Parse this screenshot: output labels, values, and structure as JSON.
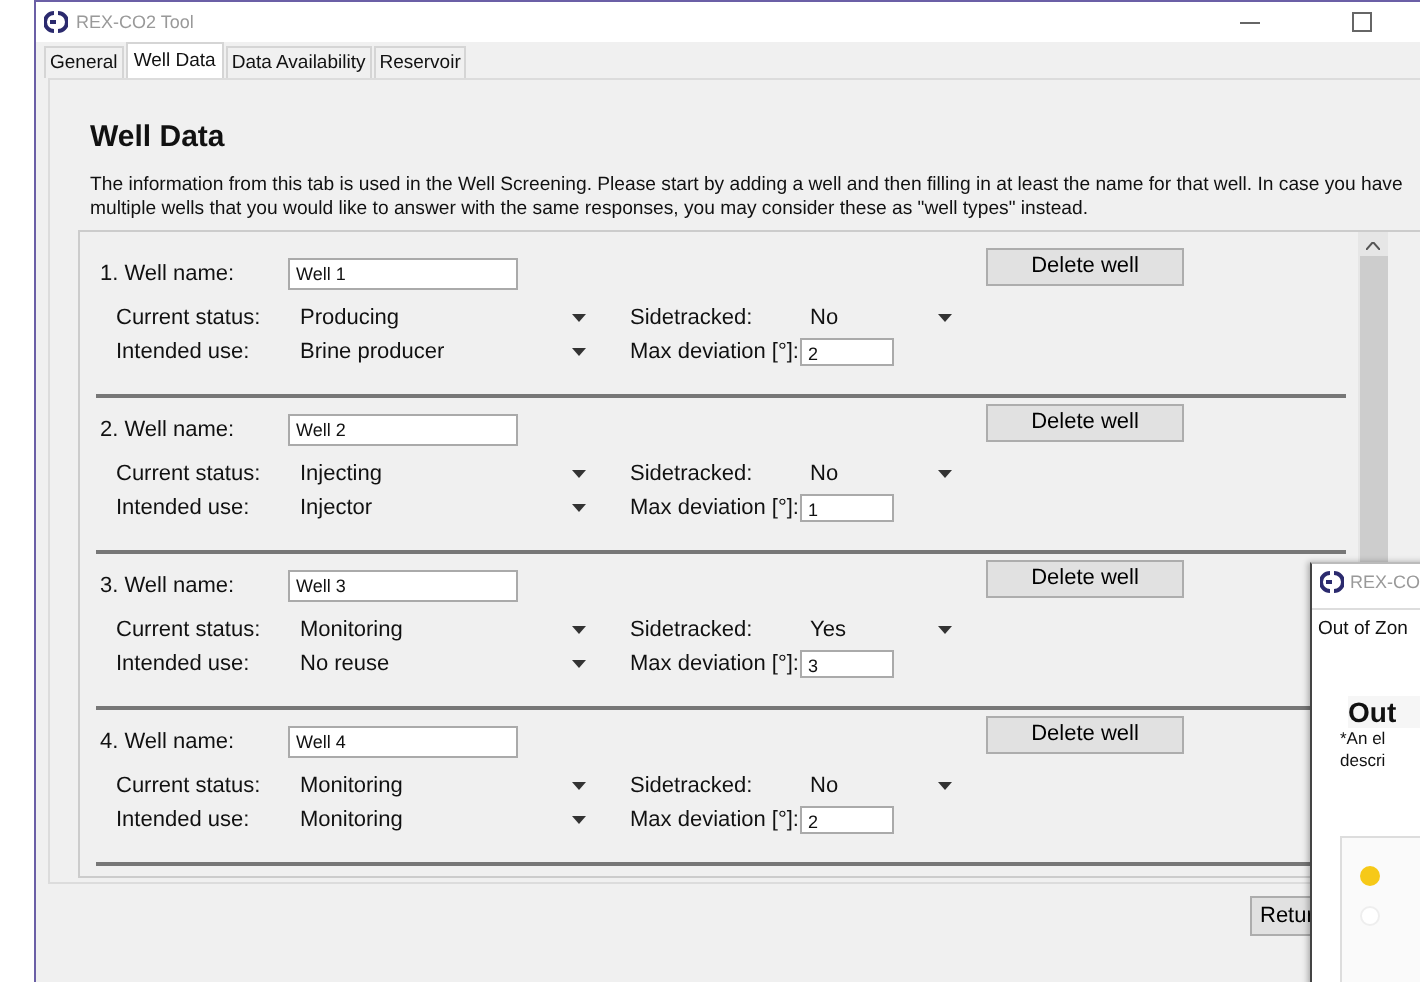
{
  "window": {
    "title": "REX-CO2 Tool"
  },
  "tabs": [
    {
      "label": "General",
      "selected": false
    },
    {
      "label": "Well Data",
      "selected": true
    },
    {
      "label": "Data Availability",
      "selected": false
    },
    {
      "label": "Reservoir",
      "selected": false
    }
  ],
  "heading": "Well Data",
  "intro": "The information from this tab is used in the Well Screening. Please start by adding a well and then filling in at least the name for that well. In case you have multiple wells that you would like to answer with the same responses, you may consider these as \"well types\" instead.",
  "wells": [
    {
      "name_label": "1. Well name:",
      "name": "Well 1",
      "delete_button": "Delete well",
      "status_label": "Current status:",
      "status": "Producing",
      "sidetracked_label": "Sidetracked:",
      "sidetracked": "No",
      "use_label": "Intended use:",
      "use": "Brine producer",
      "deviation_label": "Max deviation [°]:",
      "max_deviation": "2"
    },
    {
      "name_label": "2. Well name:",
      "name": "Well 2",
      "delete_button": "Delete well",
      "status_label": "Current status:",
      "status": "Injecting",
      "sidetracked_label": "Sidetracked:",
      "sidetracked": "No",
      "use_label": "Intended use:",
      "use": "Injector",
      "deviation_label": "Max deviation [°]:",
      "max_deviation": "1"
    },
    {
      "name_label": "3. Well name:",
      "name": "Well 3",
      "delete_button": "Delete well",
      "status_label": "Current status:",
      "status": "Monitoring",
      "sidetracked_label": "Sidetracked:",
      "sidetracked": "Yes",
      "use_label": "Intended use:",
      "use": "No reuse",
      "deviation_label": "Max deviation [°]:",
      "max_deviation": "3"
    },
    {
      "name_label": "4. Well name:",
      "name": "Well 4",
      "delete_button": "Delete well",
      "status_label": "Current status:",
      "status": "Monitoring",
      "sidetracked_label": "Sidetracked:",
      "sidetracked": "No",
      "use_label": "Intended use:",
      "use": "Monitoring",
      "deviation_label": "Max deviation [°]:",
      "max_deviation": "2"
    }
  ],
  "return_button": "Retur",
  "second_window": {
    "title": "REX-CO",
    "tab": "Out of Zon",
    "heading": "Out",
    "text_lines": [
      "*An el",
      "descri"
    ],
    "radios": [
      {
        "selected": true
      },
      {
        "selected": false
      }
    ]
  }
}
